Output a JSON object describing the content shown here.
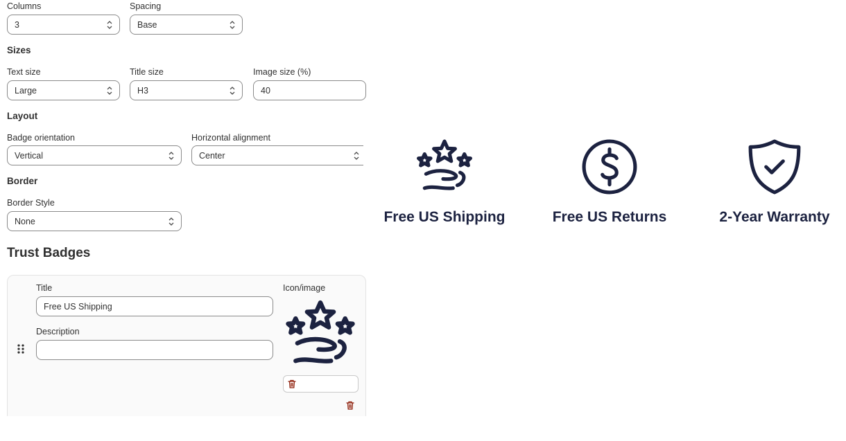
{
  "settings": {
    "columns": {
      "label": "Columns",
      "value": "3"
    },
    "spacing": {
      "label": "Spacing",
      "value": "Base"
    },
    "sizes_heading": "Sizes",
    "text_size": {
      "label": "Text size",
      "value": "Large"
    },
    "title_size": {
      "label": "Title size",
      "value": "H3"
    },
    "image_size": {
      "label": "Image size (%)",
      "value": "40"
    },
    "layout_heading": "Layout",
    "badge_orientation": {
      "label": "Badge orientation",
      "value": "Vertical"
    },
    "horizontal_alignment": {
      "label": "Horizontal alignment",
      "value": "Center"
    },
    "border_heading": "Border",
    "border_style": {
      "label": "Border Style",
      "value": "None"
    }
  },
  "trust_badges": {
    "heading": "Trust Badges",
    "item": {
      "title_label": "Title",
      "title_value": "Free US Shipping",
      "description_label": "Description",
      "description_value": "",
      "icon_label": "Icon/image",
      "icon_name": "stars-hand-icon"
    }
  },
  "preview": {
    "color": "#1c2240",
    "badges": [
      {
        "title": "Free US Shipping",
        "icon": "stars-hand-icon"
      },
      {
        "title": "Free US Returns",
        "icon": "dollar-circle-icon"
      },
      {
        "title": "2-Year Warranty",
        "icon": "shield-check-icon"
      }
    ]
  },
  "colors": {
    "danger": "#8e1f0b",
    "text": "#303030",
    "icon": "#1c2240"
  }
}
